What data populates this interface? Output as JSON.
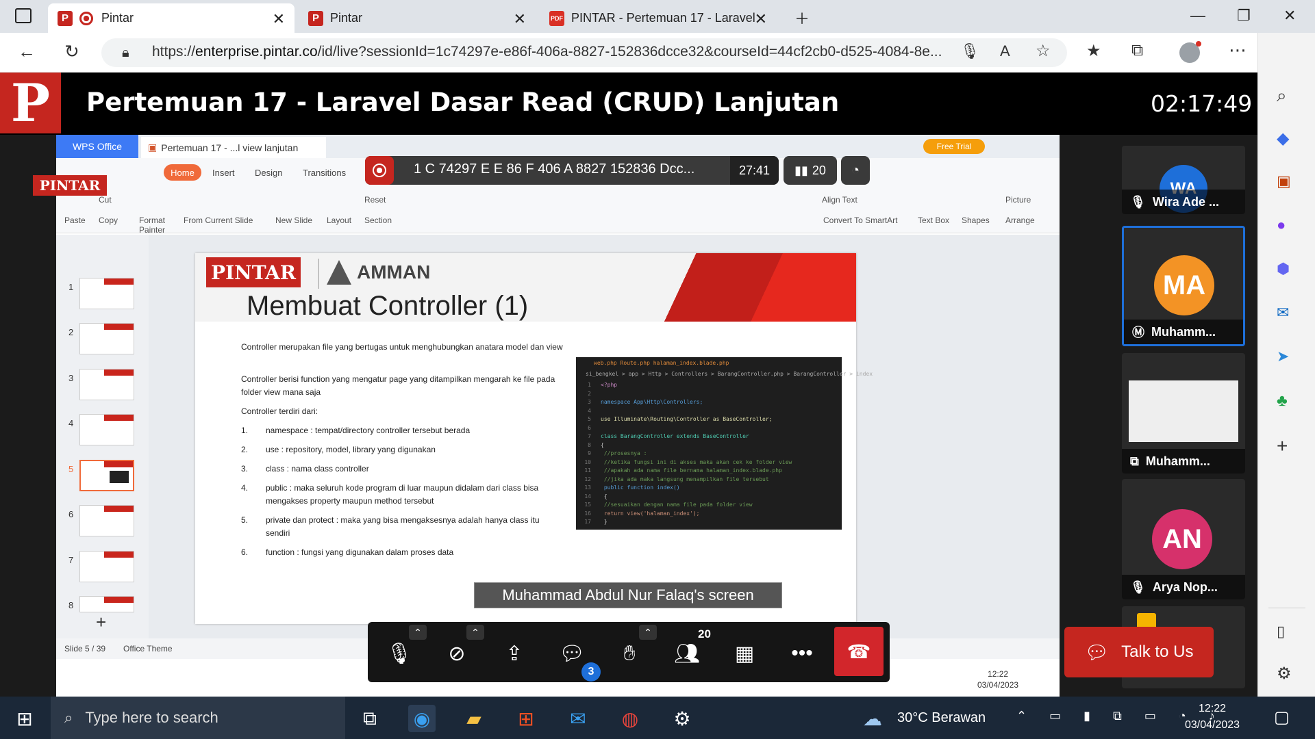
{
  "browser": {
    "tabs": [
      {
        "label": "Pintar",
        "active": true
      },
      {
        "label": "Pintar",
        "active": false
      },
      {
        "label": "PINTAR - Pertemuan 17 - Laravel",
        "active": false
      }
    ],
    "url_prefix": "https://",
    "url_host": "enterprise.pintar.co",
    "url_rest": "/id/live?sessionId=1c74297e-e86f-406a-8827-152836dcce32&courseId=44cf2cb0-d525-4084-8e..."
  },
  "meeting": {
    "title": "Pertemuan 17 - Laravel Dasar Read (CRUD) Lanjutan",
    "timer": "02:17:49",
    "logo_letter": "P",
    "session_id": "1 C 74297 E E 86 F 406 A 8827 152836 Dcc...",
    "session_time": "27:41",
    "participant_count": "20",
    "share_label": "Muhammad Abdul Nur Falaq's screen",
    "chat_badge": "3",
    "people_badge": "20",
    "talk_label": "Talk to Us"
  },
  "participants": [
    {
      "initials": "WA",
      "name": "Wira Ade ...",
      "color": "#1e6fd9"
    },
    {
      "initials": "MA",
      "name": "Muhamm...",
      "color": "#f39325"
    },
    {
      "initials": "",
      "name": "Muhamm...",
      "color": "#2a2a2a"
    },
    {
      "initials": "AN",
      "name": "Arya Nop...",
      "color": "#d6316b"
    }
  ],
  "wps": {
    "app_tab": "WPS Office",
    "doc_tab": "Pertemuan 17 - ...l view lanjutan",
    "free_trial": "Free Trial",
    "menu": [
      "Home",
      "Insert",
      "Design",
      "Transitions"
    ],
    "ribbon": {
      "paste": "Paste",
      "cut": "Cut",
      "copy": "Copy",
      "format_painter": "Format Painter",
      "from_current": "From Current Slide",
      "new_slide": "New Slide",
      "layout": "Layout",
      "reset": "Reset",
      "section": "Section",
      "align_text": "Align Text",
      "smartart": "Convert To SmartArt",
      "text_box": "Text Box",
      "shapes": "Shapes",
      "picture": "Picture",
      "arrange": "Arrange"
    },
    "status_slide": "Slide 5 / 39",
    "status_theme": "Office Theme",
    "thumb_numbers": [
      "1",
      "2",
      "3",
      "4",
      "5",
      "6",
      "7",
      "8"
    ],
    "inner_clock_time": "12:22",
    "inner_clock_date": "03/04/2023"
  },
  "pintar_watermark": "PINTAR",
  "slide": {
    "brand": "PINTAR",
    "partner": "AMMAN",
    "title": "Membuat Controller (1)",
    "p1": "Controller merupakan file yang bertugas untuk menghubungkan anatara model dan view",
    "p2": "Controller berisi function yang mengatur page yang ditampilkan mengarah ke file pada folder view mana saja",
    "p3": "Controller terdiri dari:",
    "items": [
      {
        "n": "1.",
        "t": "namespace : tempat/directory controller tersebut berada"
      },
      {
        "n": "2.",
        "t": "use : repository, model, library yang digunakan"
      },
      {
        "n": "3.",
        "t": "class : nama class controller"
      },
      {
        "n": "4.",
        "t": "public : maka seluruh kode program di luar maupun didalam dari class bisa mengakses property maupun method tersebut"
      },
      {
        "n": "5.",
        "t": "private dan protect : maka yang bisa mengaksesnya adalah hanya class itu sendiri"
      },
      {
        "n": "6.",
        "t": "function : fungsi yang digunakan dalam proses data"
      }
    ],
    "code_tabs": "web.php  Route.php  halaman_index.blade.php",
    "code_path": "si_bengkel > app > Http > Controllers > BarangController.php > BarangController > index",
    "code_lines": [
      {
        "n": "1",
        "t": "<?php",
        "c": "#c586c0"
      },
      {
        "n": "2",
        "t": "",
        "c": "#ccc"
      },
      {
        "n": "3",
        "t": "namespace App\\Http\\Controllers;",
        "c": "#569cd6"
      },
      {
        "n": "4",
        "t": "",
        "c": "#ccc"
      },
      {
        "n": "5",
        "t": "use Illuminate\\Routing\\Controller as BaseController;",
        "c": "#dcdcaa"
      },
      {
        "n": "6",
        "t": "",
        "c": "#ccc"
      },
      {
        "n": "7",
        "t": "class BarangController extends BaseController",
        "c": "#4ec9b0"
      },
      {
        "n": "8",
        "t": "{",
        "c": "#ccc"
      },
      {
        "n": "9",
        "t": "    //prosesnya :",
        "c": "#6a9955"
      },
      {
        "n": "10",
        "t": "    //ketika fungsi ini di akses maka akan cek ke folder view",
        "c": "#6a9955"
      },
      {
        "n": "11",
        "t": "    //apakah ada nama file bernama halaman_index.blade.php",
        "c": "#6a9955"
      },
      {
        "n": "12",
        "t": "    //jika ada maka langsung menampilkan file tersebut",
        "c": "#6a9955"
      },
      {
        "n": "13",
        "t": "    public function index()",
        "c": "#569cd6"
      },
      {
        "n": "14",
        "t": "    {",
        "c": "#ccc"
      },
      {
        "n": "15",
        "t": "        //sesuaikan dengan nama file pada folder view",
        "c": "#6a9955"
      },
      {
        "n": "16",
        "t": "        return view('halaman_index');",
        "c": "#ce9178"
      },
      {
        "n": "17",
        "t": "    }",
        "c": "#ccc"
      }
    ]
  },
  "taskbar": {
    "search_placeholder": "Type here to search",
    "weather": "30°C  Berawan",
    "time": "12:22",
    "date": "03/04/2023"
  }
}
